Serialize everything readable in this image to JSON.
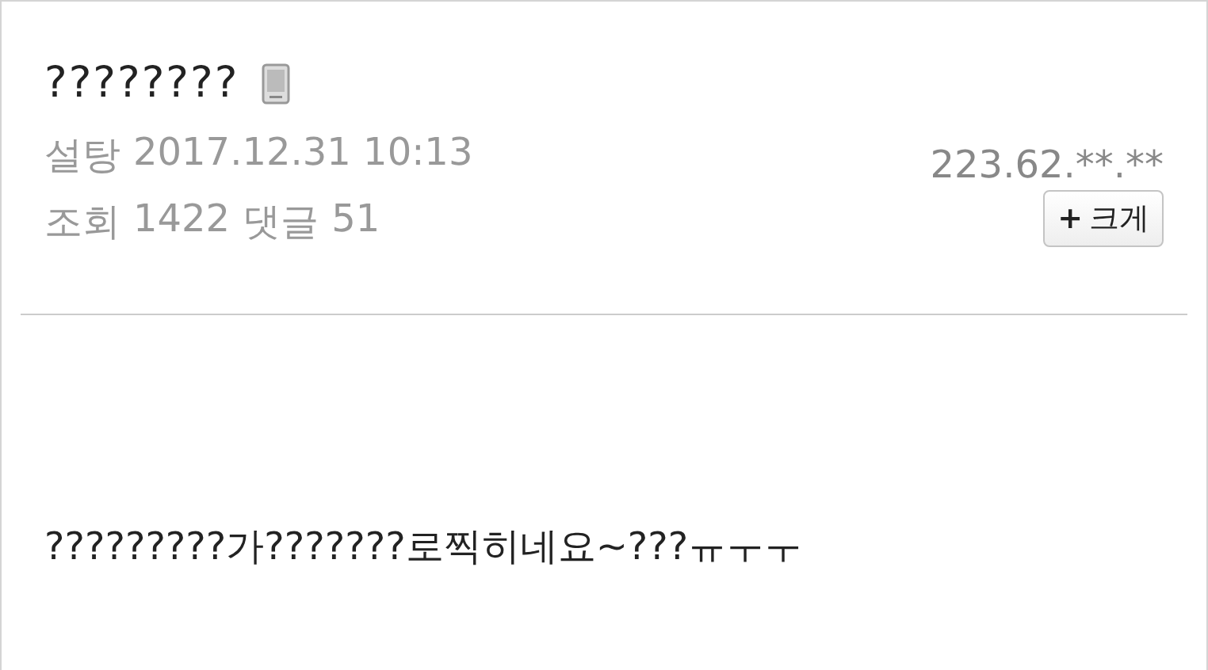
{
  "post": {
    "title": "????????",
    "nickname": "설탕",
    "date": "2017.12.31 10:13",
    "ip": "223.62.**.**",
    "views_label": "조회",
    "views": "1422",
    "comments_label": "댓글",
    "comments": "51",
    "enlarge_button": {
      "icon": "+",
      "label": "크게"
    },
    "body": "?????????가???????로찍히네요~???ㅠㅜㅜ"
  }
}
